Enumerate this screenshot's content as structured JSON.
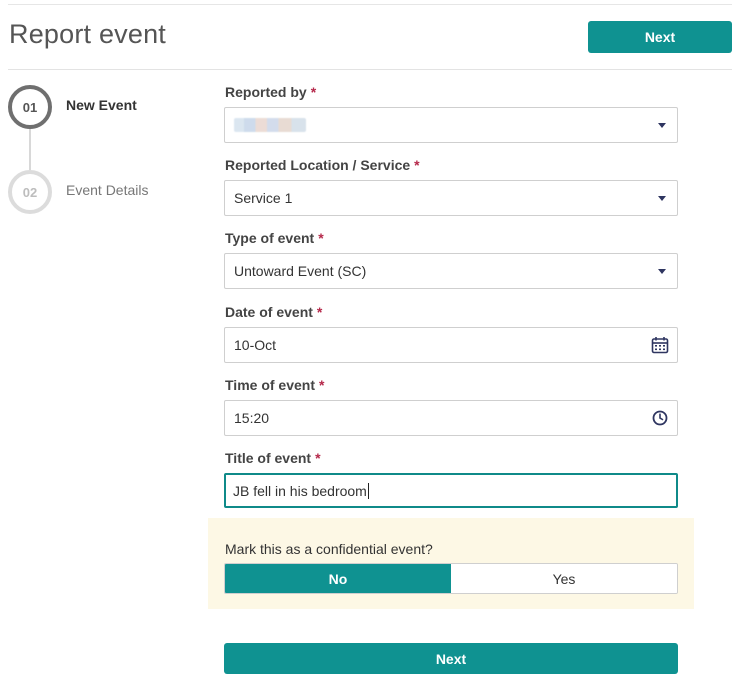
{
  "header": {
    "title": "Report event",
    "next_label": "Next"
  },
  "stepper": {
    "steps": [
      {
        "number": "01",
        "label": "New Event",
        "state": "active"
      },
      {
        "number": "02",
        "label": "Event Details",
        "state": "inactive"
      }
    ]
  },
  "form": {
    "required_marker": "*",
    "reported_by": {
      "label": "Reported by",
      "value": ""
    },
    "location": {
      "label": "Reported Location / Service",
      "value": "Service 1"
    },
    "type": {
      "label": "Type of event",
      "value": "Untoward Event (SC)"
    },
    "date": {
      "label": "Date of event",
      "value": "10-Oct",
      "icon": "calendar-icon"
    },
    "time": {
      "label": "Time of event",
      "value": "15:20",
      "icon": "clock-icon"
    },
    "title": {
      "label": "Title of event",
      "value": "JB fell in his bedroom"
    }
  },
  "confidential": {
    "question": "Mark this as a confidential event?",
    "no_label": "No",
    "yes_label": "Yes",
    "selected": "No"
  },
  "footer": {
    "next_label": "Next"
  },
  "colors": {
    "accent": "#0f9291",
    "required": "#b5284a",
    "panel_bg": "#fdf8e5",
    "icon": "#2e3560"
  }
}
